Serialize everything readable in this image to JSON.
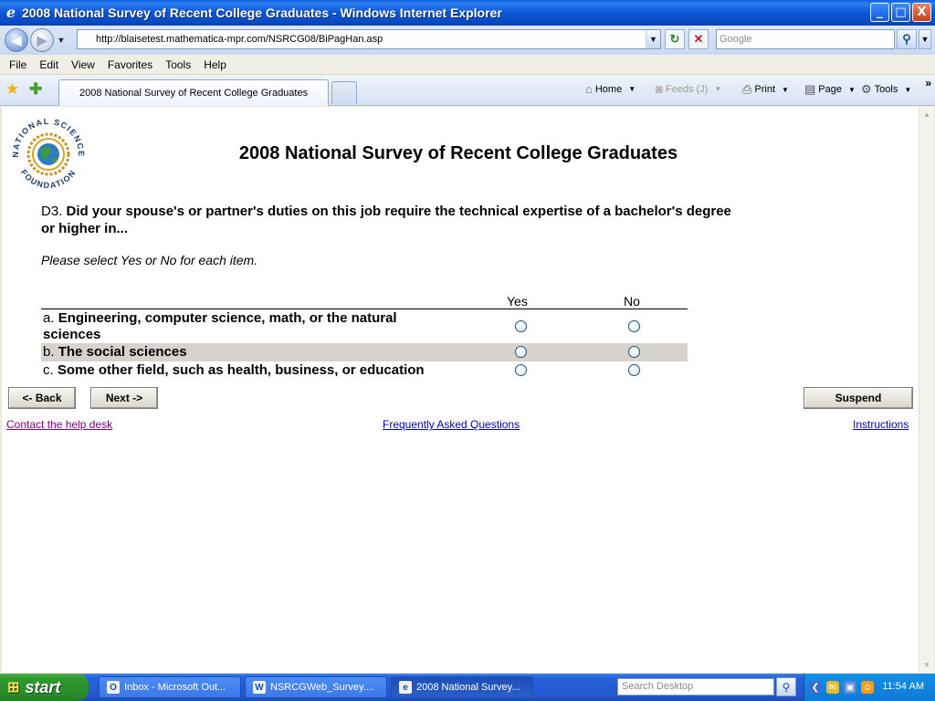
{
  "window": {
    "title": "2008 National Survey of Recent College Graduates - Windows Internet Explorer",
    "controls": {
      "minimize": "_",
      "maximize": "□",
      "close": "X"
    }
  },
  "address_bar": {
    "url": "http://blaisetest.mathematica-mpr.com/NSRCG08/BiPagHan.asp",
    "search_placeholder": "Google"
  },
  "menu": [
    "File",
    "Edit",
    "View",
    "Favorites",
    "Tools",
    "Help"
  ],
  "tabs": [
    {
      "label": "2008 National Survey of Recent College Graduates",
      "active": true
    }
  ],
  "command_bar": {
    "home": "Home",
    "feeds": "Feeds (J)",
    "print": "Print",
    "page": "Page",
    "tools": "Tools"
  },
  "survey": {
    "logo_text_top": "NATIONAL SCIENCE",
    "logo_text_bottom": "FOUNDATION",
    "title": "2008 National Survey of Recent College Graduates",
    "question_number": "D3.",
    "question_text": "Did your spouse's or partner's duties on this job require the technical expertise of a bachelor's degree or higher in...",
    "instruction": "Please select Yes or No for each item.",
    "columns": {
      "yes": "Yes",
      "no": "No"
    },
    "items": [
      {
        "letter": "a.",
        "label": "Engineering, computer science, math, or the natural sciences"
      },
      {
        "letter": "b.",
        "label": "The social sciences"
      },
      {
        "letter": "c.",
        "label": "Some other field, such as health, business, or education"
      }
    ],
    "buttons": {
      "back": "<- Back",
      "next": "Next ->",
      "suspend": "Suspend"
    },
    "links": {
      "help_desk": "Contact the help desk",
      "faq": "Frequently Asked Questions",
      "instructions": "Instructions"
    }
  },
  "taskbar": {
    "start": "start",
    "tasks": [
      {
        "label": "Inbox - Microsoft Out...",
        "icon": "outlook-icon",
        "active": false
      },
      {
        "label": "NSRCGWeb_Survey....",
        "icon": "word-icon",
        "active": false
      },
      {
        "label": "2008 National Survey...",
        "icon": "ie-icon",
        "active": true
      }
    ],
    "desktop_search_placeholder": "Search Desktop",
    "clock": "11:54 AM"
  }
}
